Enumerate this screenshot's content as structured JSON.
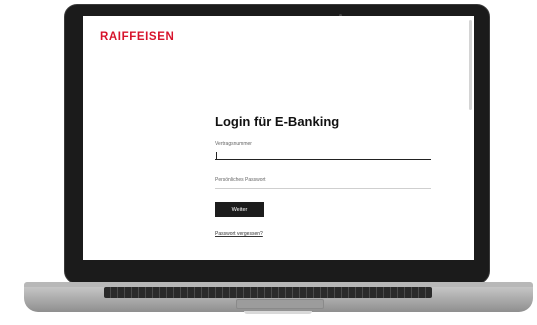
{
  "brand": {
    "logo_text": "RAIFFEISEN",
    "accent_color": "#d7142c"
  },
  "login": {
    "title": "Login für E-Banking",
    "contract_number_label": "Vertragsnummer",
    "contract_number_value": "",
    "password_label": "Persönliches Passwort",
    "password_value": "",
    "submit_label": "Weiter",
    "forgot_password_label": "Passwort vergessen?"
  }
}
